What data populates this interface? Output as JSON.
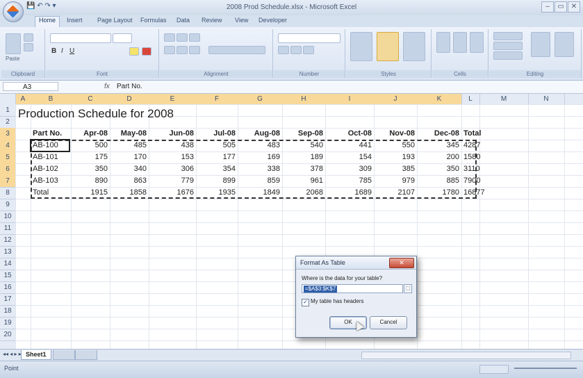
{
  "window": {
    "title": "2008 Prod Schedule.xlsx - Microsoft Excel",
    "controls": [
      "–",
      "▭",
      "✕"
    ]
  },
  "ribbon": {
    "tabs": [
      "Home",
      "Insert",
      "Page Layout",
      "Formulas",
      "Data",
      "Review",
      "View",
      "Developer"
    ],
    "groups": [
      "Clipboard",
      "Font",
      "Alignment",
      "Number",
      "Styles",
      "Cells",
      "Editing"
    ],
    "paste_label": "Paste"
  },
  "formula_bar": {
    "name_box": "A3",
    "fx": "fx",
    "value": "Part No."
  },
  "sheet": {
    "columns": [
      "A",
      "B",
      "C",
      "D",
      "E",
      "F",
      "G",
      "H",
      "I",
      "J",
      "K",
      "L",
      "M",
      "N"
    ],
    "rows": [
      "1",
      "2",
      "3",
      "4",
      "5",
      "6",
      "7",
      "8",
      "9",
      "10",
      "11",
      "12",
      "13",
      "14",
      "15",
      "16",
      "17",
      "18",
      "19",
      "20"
    ],
    "title": "Production Schedule for 2008",
    "headers": [
      "Part No.",
      "Apr-08",
      "May-08",
      "Jun-08",
      "Jul-08",
      "Aug-08",
      "Sep-08",
      "Oct-08",
      "Nov-08",
      "Dec-08",
      "Total"
    ],
    "data": [
      [
        "AB-100",
        "500",
        "485",
        "438",
        "505",
        "483",
        "540",
        "441",
        "550",
        "345",
        "4287"
      ],
      [
        "AB-101",
        "175",
        "170",
        "153",
        "177",
        "169",
        "189",
        "154",
        "193",
        "200",
        "1580"
      ],
      [
        "AB-102",
        "350",
        "340",
        "306",
        "354",
        "338",
        "378",
        "309",
        "385",
        "350",
        "3110"
      ],
      [
        "AB-103",
        "890",
        "863",
        "779",
        "899",
        "859",
        "961",
        "785",
        "979",
        "885",
        "7900"
      ]
    ],
    "totals": [
      "Total",
      "1915",
      "1858",
      "1676",
      "1935",
      "1849",
      "2068",
      "1689",
      "2107",
      "1780",
      "16877"
    ]
  },
  "sheet_tabs": {
    "active": "Sheet1"
  },
  "status": {
    "mode": "Point"
  },
  "dialog": {
    "title": "Format As Table",
    "question": "Where is the data for your table?",
    "range": "=$A$3:$K$7",
    "checkbox_label": "My table has headers",
    "checkbox_checked": true,
    "ok_label": "OK",
    "cancel_label": "Cancel",
    "close_glyph": "✕"
  }
}
